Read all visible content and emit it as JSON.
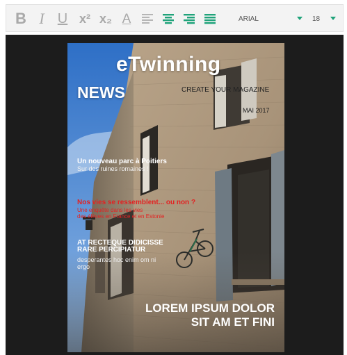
{
  "toolbar": {
    "font_family": "ARIAL",
    "font_size": "18",
    "accent_color": "#1fa37a",
    "inactive_color": "#a7a7a7",
    "buttons": [
      {
        "icon": "bold-icon",
        "label": "B"
      },
      {
        "icon": "italic-icon",
        "label": "I"
      },
      {
        "icon": "underline-icon",
        "label": "U"
      },
      {
        "icon": "superscript-icon",
        "label": "x²"
      },
      {
        "icon": "subscript-icon",
        "label": "x₂"
      },
      {
        "icon": "font-color-icon",
        "label": "A"
      },
      {
        "icon": "align-left-icon"
      },
      {
        "icon": "align-center-icon"
      },
      {
        "icon": "align-right-icon"
      },
      {
        "icon": "align-justify-icon"
      }
    ]
  },
  "cover": {
    "brand": "eTwinning",
    "section": "NEWS",
    "tagline": "CREATE YOUR MAGAZINE",
    "date": "MAI 2017",
    "story1": {
      "headline": "Un nouveau parc à Poitiers",
      "sub": "Sur des ruines romaines !"
    },
    "story2": {
      "headline": "Nos vies se ressemblent... ou non ?",
      "sub_line1": "Une enquête dans les vies",
      "sub_line2": "des élèves en France et en Estonie"
    },
    "story3": {
      "headline_line1": "AT RECTEQUE DIDICISSE",
      "headline_line2": "RARE PERCIPIATUR",
      "sub_line1": "desperantes hoc enim om ni",
      "sub_line2": "ergo"
    },
    "lead": {
      "line1": "LOREM IPSUM DOLOR",
      "line2": "SIT AM ET FINI"
    },
    "story2_color": "#e32222"
  }
}
